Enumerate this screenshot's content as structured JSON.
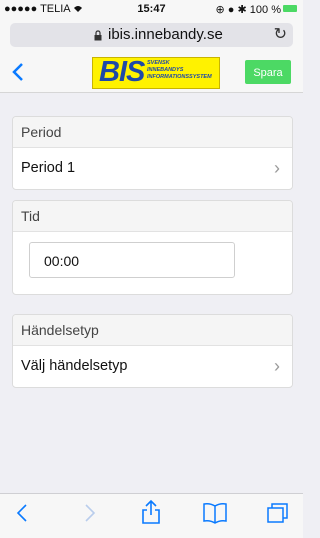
{
  "status": {
    "carrier": "●●●●● TELIA",
    "time": "15:47",
    "battery": "100 %"
  },
  "browser": {
    "url": "ibis.innebandy.se"
  },
  "appbar": {
    "logo_main": "BIS",
    "logo_sub": [
      "SVENSK",
      "INNEBANDYS",
      "INFORMATIONSSYSTEM"
    ],
    "save_label": "Spara"
  },
  "period": {
    "heading": "Period",
    "value": "Period 1"
  },
  "tid": {
    "heading": "Tid",
    "value": "00:00"
  },
  "handelsetyp": {
    "heading": "Händelsetyp",
    "value": "Välj händelsetyp"
  },
  "colors": {
    "accent": "#0a7aff",
    "save_green": "#4cd964",
    "logo_yellow": "#fff200",
    "logo_blue": "#1e49a8"
  },
  "icons": [
    "wifi-icon",
    "lock-icon",
    "reload-icon",
    "back-chevron-icon",
    "chevron-right-icon",
    "share-icon",
    "bookmarks-icon",
    "tabs-icon"
  ]
}
